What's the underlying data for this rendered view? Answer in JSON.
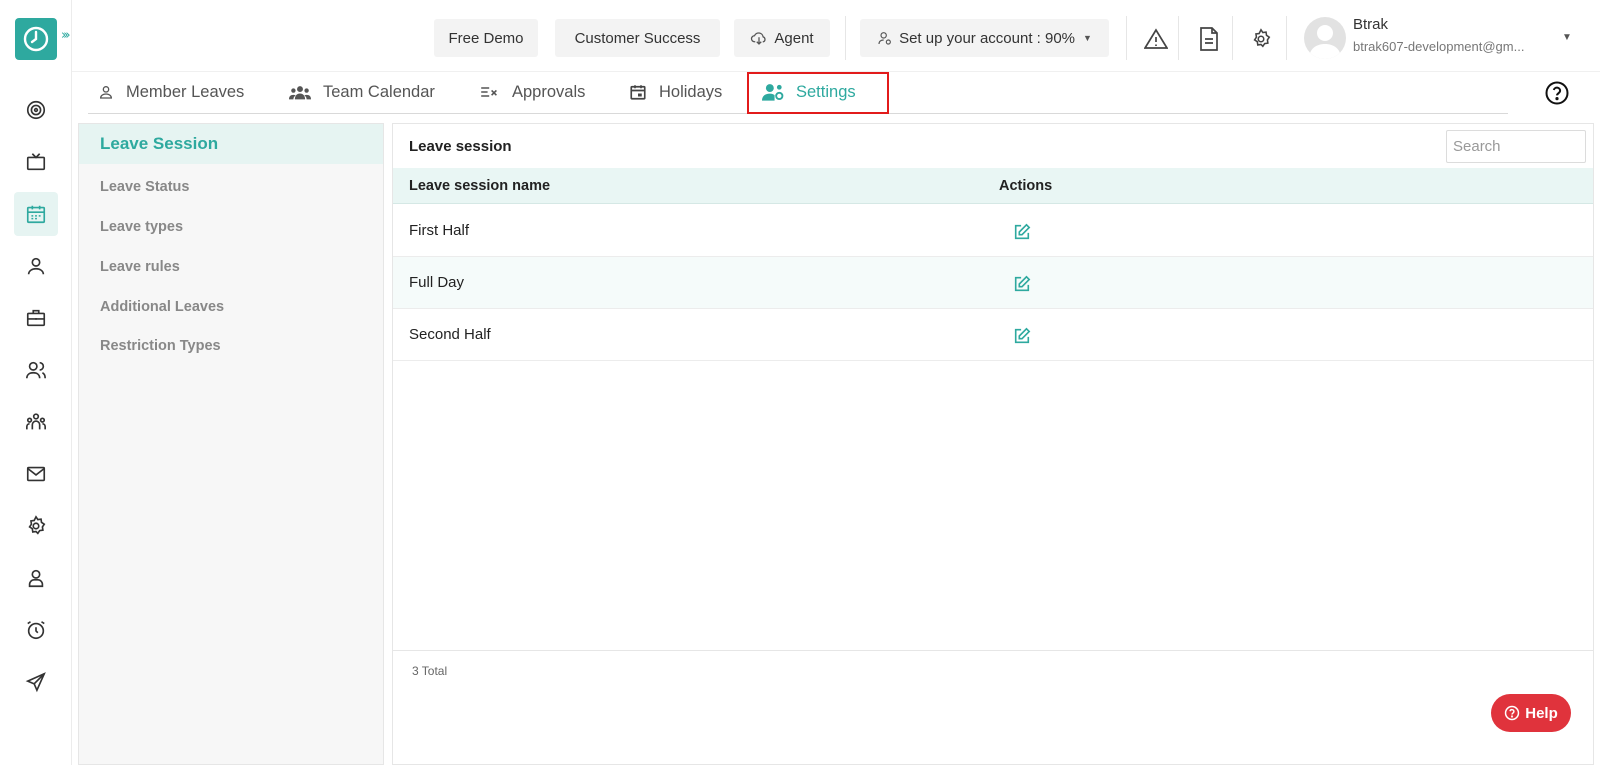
{
  "header": {
    "free_demo": "Free Demo",
    "customer_success": "Customer Success",
    "agent": "Agent",
    "setup_account": "Set up your account : 90%",
    "user_name": "Btrak",
    "user_email": "btrak607-development@gm..."
  },
  "tabs": {
    "member_leaves": "Member Leaves",
    "team_calendar": "Team Calendar",
    "approvals": "Approvals",
    "holidays": "Holidays",
    "settings": "Settings"
  },
  "settings_menu": {
    "items": [
      "Leave Session",
      "Leave Status",
      "Leave types",
      "Leave rules",
      "Additional Leaves",
      "Restriction Types"
    ],
    "active": "Leave Session"
  },
  "main": {
    "title": "Leave session",
    "search_placeholder": "Search",
    "columns": {
      "name": "Leave session name",
      "actions": "Actions"
    },
    "rows": [
      "First Half",
      "Full Day",
      "Second Half"
    ],
    "total": "3 Total"
  },
  "help_button": "Help",
  "colors": {
    "accent": "#2ea99f",
    "highlight": "#e21b1b",
    "help": "#e0333c"
  }
}
